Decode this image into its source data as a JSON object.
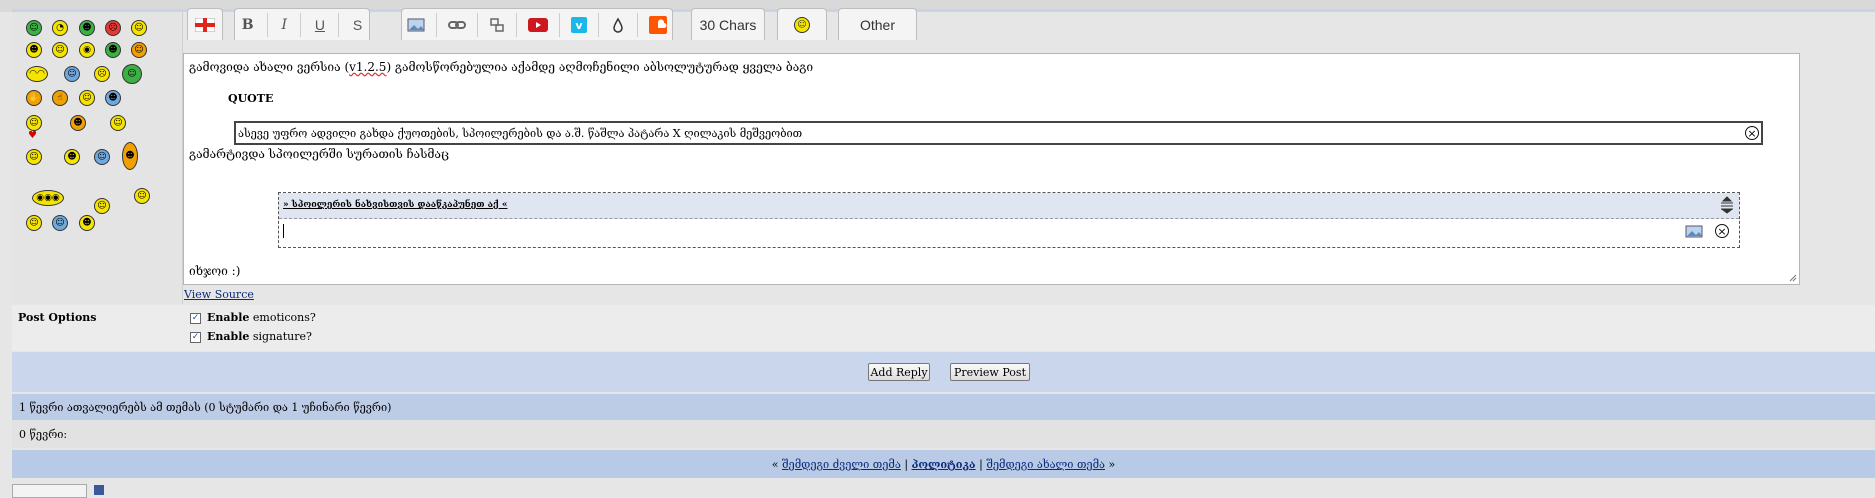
{
  "editor": {
    "toolbar": {
      "bold": "B",
      "italic": "I",
      "underline": "U",
      "strike": "S",
      "chars_button": "30 Chars",
      "other_button": "Other"
    },
    "lines": {
      "line1_prefix": "გამოვიდა ახალი ვერსია (",
      "line1_version": "v1.2.5",
      "line1_suffix": ") გამოსწორებულია აქამდე აღმოჩენილი აბსოლუტურად ყველა ბაგი",
      "quote_label": "QUOTE",
      "quote_text": "ასევე უფრო ადვილი გახდა ქუოთების, სპოილერების და ა.შ. წაშლა პატარა X ღილაკის მეშვეობით",
      "line2": "გამარტივდა სპოილერში სურათის ჩასმაც",
      "spoiler_title": "» სპოილერის ნახვისთვის დააწკაპუნეთ აქ «",
      "line3": "იხჯოი :)"
    },
    "view_source": "View Source"
  },
  "post_options": {
    "label": "Post Options",
    "enable_word": "Enable",
    "opt1_rest": "emoticons?",
    "opt2_rest": "signature?",
    "opt1_checked": true,
    "opt2_checked": true
  },
  "buttons": {
    "add_reply": "Add Reply",
    "preview_post": "Preview Post"
  },
  "readers": {
    "summary": "1 წევრი ათვალიერებს ამ თემას (0 სტუმარი და 1 უჩინარი წევრი)",
    "members": "0 წევრი:"
  },
  "nav": {
    "open_quote": "«",
    "prev": "შემდეგი ძველი თემა",
    "sep1": "|",
    "forum": "პოლიტიკა",
    "sep2": "|",
    "next": "შემდეგი ახალი თემა",
    "close_quote": "»"
  },
  "colors": {
    "accent_blue": "#c9d6eb",
    "nav_blue": "#b8cae6",
    "link": "#0b2b7a"
  },
  "icons": {
    "flag": "georgia-flag-icon",
    "image": "image-icon",
    "link": "link-icon",
    "youtube": "youtube-icon",
    "vimeo": "vimeo-icon",
    "soundcloud": "soundcloud-icon",
    "smiley": "smiley-icon"
  }
}
